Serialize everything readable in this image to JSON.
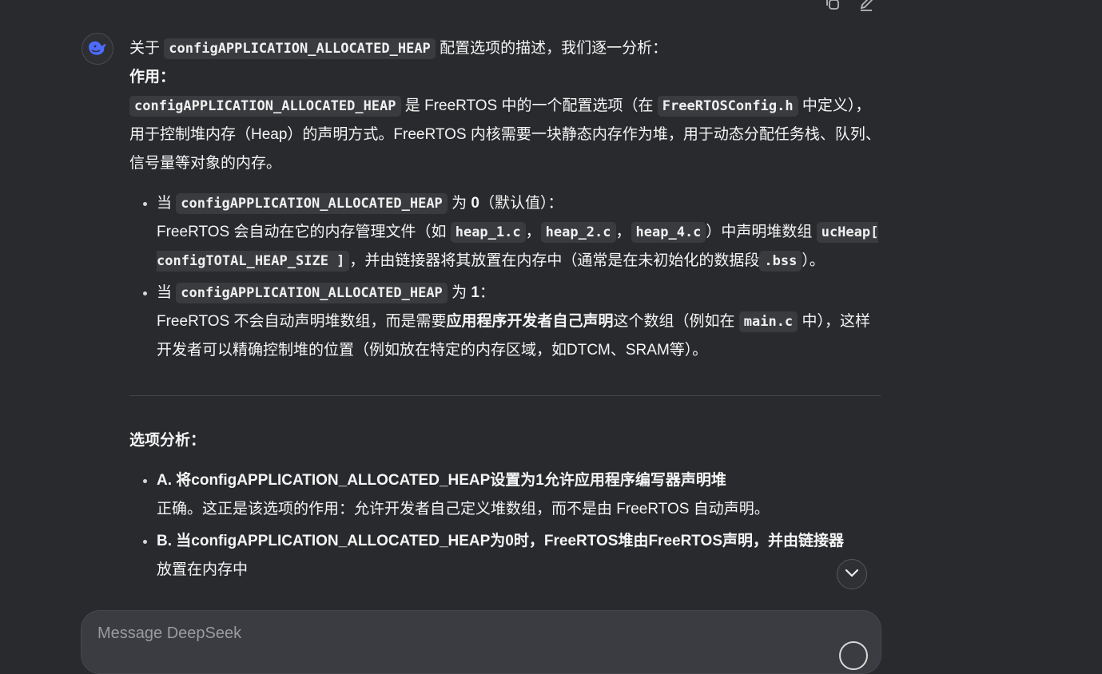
{
  "intro": {
    "prefix": "关于 ",
    "code": "configAPPLICATION_ALLOCATED_HEAP",
    "suffix": " 配置选项的描述，我们逐一分析："
  },
  "purpose": {
    "heading": "作用：",
    "code1": "configAPPLICATION_ALLOCATED_HEAP",
    "text1": " 是 FreeRTOS 中的一个配置选项（在 ",
    "code2": "FreeRTOSConfig.h",
    "text2": " 中定义），用于控制堆内存（Heap）的声明方式。FreeRTOS 内核需要一块静态内存作为堆，用于动态分配任务栈、队列、信号量等对象的内存。"
  },
  "bullets": [
    {
      "pre": "当 ",
      "code": "configAPPLICATION_ALLOCATED_HEAP",
      "mid": " 为 ",
      "value": "0",
      "post": "（默认值）：",
      "d1": "FreeRTOS 会自动在它的内存管理文件（如 ",
      "f1": "heap_1.c",
      "sep1": "，",
      "f2": "heap_2.c",
      "sep2": "，",
      "f3": "heap_4.c",
      "d2": "）中声明堆数组 ",
      "arr": "ucHeap[ configTOTAL_HEAP_SIZE ]",
      "d3": "，并由链接器将其放置在内存中（通常是在未初始化的数据段",
      "bss": ".bss",
      "d4": "）。"
    },
    {
      "pre": "当 ",
      "code": "configAPPLICATION_ALLOCATED_HEAP",
      "mid": " 为 ",
      "value": "1",
      "post": "：",
      "d1": "FreeRTOS 不会自动声明堆数组，而是需要",
      "bold": "应用程序开发者自己声明",
      "d2": "这个数组（例如在 ",
      "file": "main.c",
      "d3": " 中），这样开发者可以精确控制堆的位置（例如放在特定的内存区域，如DTCM、SRAM等）。"
    }
  ],
  "analysis": {
    "heading": "选项分析：",
    "items": [
      {
        "title": "A. 将configAPPLICATION_ALLOCATED_HEAP设置为1允许应用程序编写器声明堆",
        "desc": "正确。这正是该选项的作用：允许开发者自己定义堆数组，而不是由 FreeRTOS 自动声明。"
      },
      {
        "title": "B. 当configAPPLICATION_ALLOCATED_HEAP为0时，FreeRTOS堆由FreeRTOS声明，并由链接器",
        "desc": "放置在内存中"
      }
    ]
  },
  "composer": {
    "placeholder": "Message DeepSeek"
  },
  "icons": {
    "copy": "copy-icon",
    "edit": "edit-icon",
    "avatar": "deepseek-whale-icon",
    "scroll": "chevron-down-icon"
  }
}
